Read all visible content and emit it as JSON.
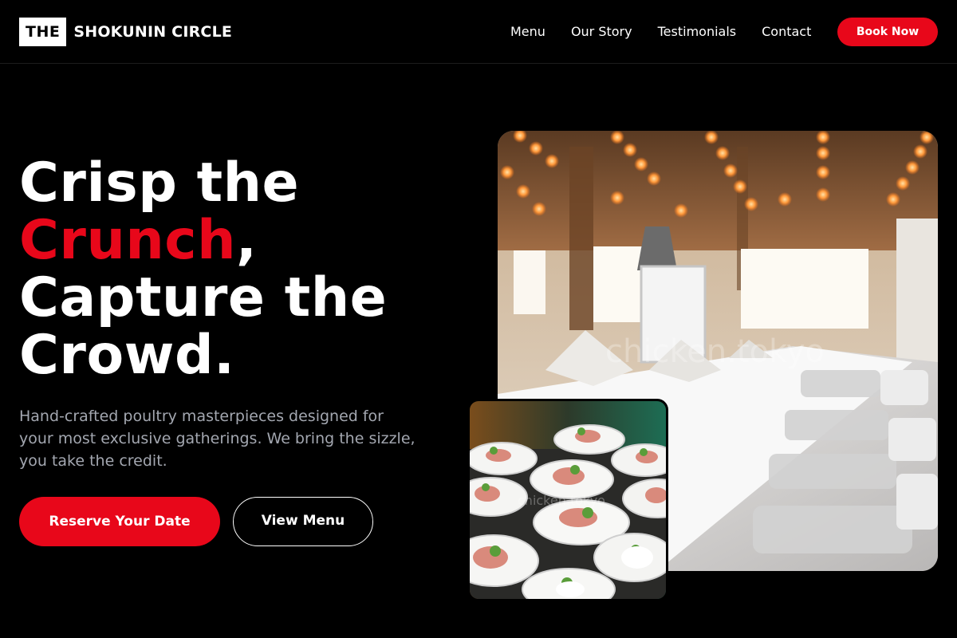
{
  "brand": {
    "box": "THE",
    "name": "SHOKUNIN CIRCLE"
  },
  "nav": {
    "links": [
      "Menu",
      "Our Story",
      "Testimonials",
      "Contact"
    ],
    "cta": "Book Now"
  },
  "hero": {
    "title_line1": "Crisp the",
    "title_highlight": "Crunch",
    "title_comma": ",",
    "title_line3": "Capture the",
    "title_line4": "Crowd.",
    "subtitle": "Hand-crafted poultry masterpieces designed for your most exclusive gatherings. We bring the sizzle, you take the credit.",
    "primary_button": "Reserve Your Date",
    "secondary_button": "View Menu"
  },
  "images": {
    "main_watermark": "chicken.tokyo",
    "small_watermark": "chicken.tokyo"
  },
  "colors": {
    "accent": "#e8071a",
    "background": "#000000",
    "muted_text": "#a3a7b0"
  }
}
